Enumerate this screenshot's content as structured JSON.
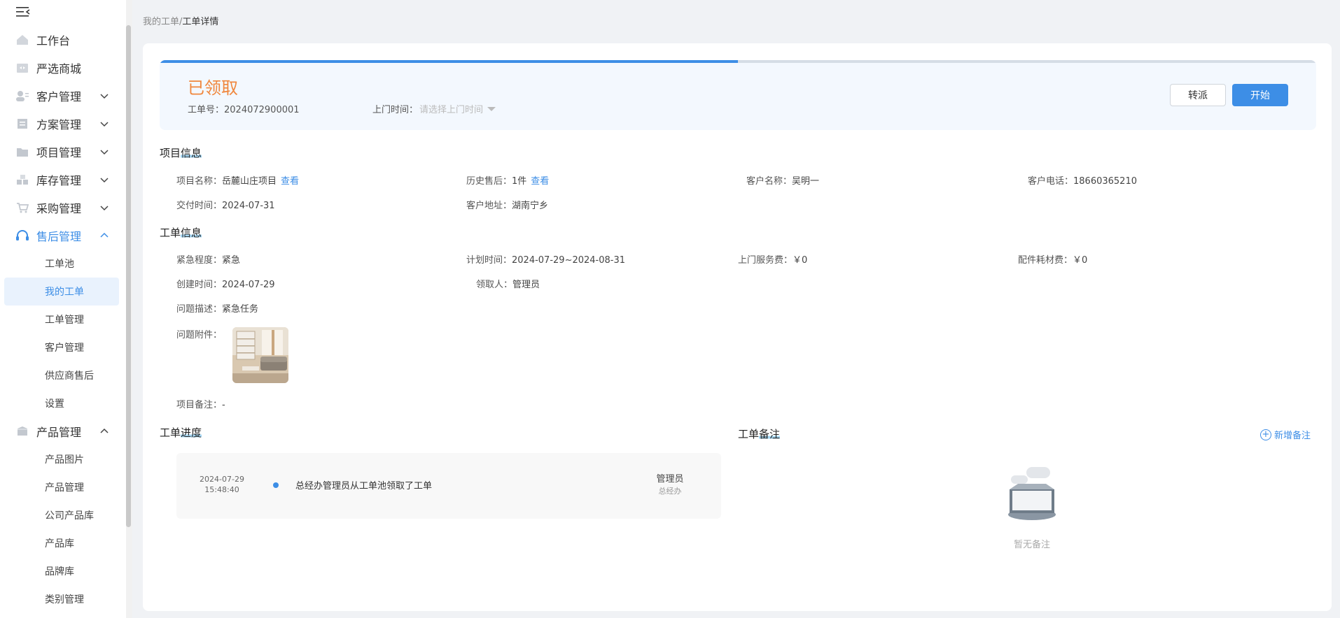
{
  "sidebar": {
    "menu": [
      {
        "label": "工作台",
        "icon": "home-icon"
      },
      {
        "label": "严选商城",
        "icon": "shop-icon"
      },
      {
        "label": "客户管理",
        "icon": "customer-icon",
        "expand": "down"
      },
      {
        "label": "方案管理",
        "icon": "scheme-icon",
        "expand": "down"
      },
      {
        "label": "项目管理",
        "icon": "folder-icon",
        "expand": "down"
      },
      {
        "label": "库存管理",
        "icon": "inventory-icon",
        "expand": "down"
      },
      {
        "label": "采购管理",
        "icon": "cart-icon",
        "expand": "down"
      },
      {
        "label": "售后管理",
        "icon": "headset-icon",
        "expand": "up",
        "active": true
      }
    ],
    "aftersales_sub": [
      "工单池",
      "我的工单",
      "工单管理",
      "客户管理",
      "供应商售后",
      "设置"
    ],
    "product": {
      "label": "产品管理",
      "icon": "box-icon",
      "expand": "up"
    },
    "product_sub": [
      "产品图片",
      "产品管理",
      "公司产品库",
      "产品库",
      "品牌库",
      "类别管理"
    ]
  },
  "breadcrumb": {
    "parent": "我的工单",
    "sep": "/",
    "current": "工单详情"
  },
  "status": {
    "title": "已领取",
    "progress": 0.5,
    "order_no_label": "工单号：",
    "order_no": "2024072900001",
    "visit_label": "上门时间：",
    "visit_placeholder": "请选择上门时间",
    "btn_transfer": "转派",
    "btn_start": "开始",
    "accent": "#3d8ee6",
    "status_color": "#f0873d"
  },
  "project_info": {
    "title_a": "项目",
    "title_b": "信息",
    "name_label": "项目名称：",
    "name": "岳麓山庄项目",
    "name_link": "查看",
    "history_label": "历史售后：",
    "history": "1件",
    "history_link": "查看",
    "customer_label": "客户名称：",
    "customer": "吴明一",
    "phone_label": "客户电话：",
    "phone": "18660365210",
    "delivery_label": "交付时间：",
    "delivery": "2024-07-31",
    "address_label": "客户地址：",
    "address": "湖南宁乡"
  },
  "order_info": {
    "title_a": "工单",
    "title_b": "信息",
    "urgency_label": "紧急程度：",
    "urgency": "紧急",
    "plan_label": "计划时间：",
    "plan": "2024-07-29~2024-08-31",
    "service_fee_label": "上门服务费：",
    "service_fee": "￥0",
    "parts_fee_label": "配件耗材费：",
    "parts_fee": "￥0",
    "created_label": "创建时间：",
    "created": "2024-07-29",
    "receiver_label": "领取人：",
    "receiver": "管理员",
    "desc_label": "问题描述：",
    "desc": "紧急任务",
    "attach_label": "问题附件：",
    "remark_label": "项目备注：",
    "remark": "-"
  },
  "progress_section": {
    "title_a": "工单",
    "title_b": "进度",
    "items": [
      {
        "date": "2024-07-29",
        "time": "15:48:40",
        "text": "总经办管理员从工单池领取了工单",
        "user": "管理员",
        "dept": "总经办"
      }
    ]
  },
  "notes_section": {
    "title_a": "工单",
    "title_b": "备注",
    "add": "新增备注",
    "empty": "暂无备注"
  }
}
